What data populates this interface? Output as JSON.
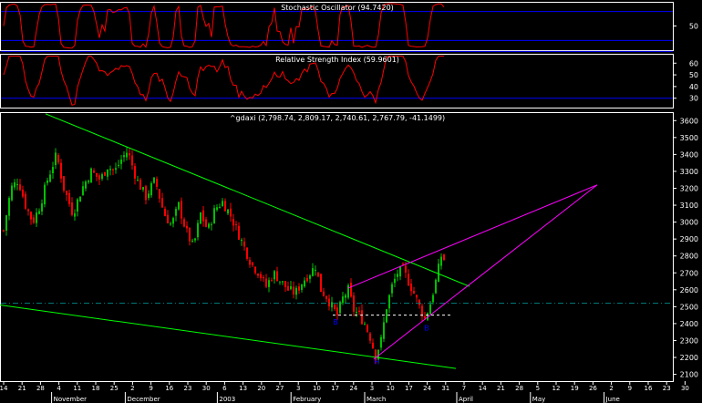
{
  "panels": {
    "stoch": {
      "title": "Stochastic Oscillator (94.7420)",
      "ylim": [
        0,
        100
      ],
      "ticks": [
        50
      ],
      "levels": [
        20,
        80
      ]
    },
    "rsi": {
      "title": "Relative Strength Index (59.9601)",
      "ylim": [
        22,
        68
      ],
      "ticks": [
        30,
        40,
        50,
        60
      ],
      "levels": [
        30,
        70
      ]
    },
    "price": {
      "title": "^gdaxi (2,798.74, 2,809.17, 2,740.61, 2,767.79, -41.1499)",
      "ylim": [
        2060,
        3650
      ],
      "ticks": [
        2100,
        2200,
        2300,
        2400,
        2500,
        2600,
        2700,
        2800,
        2900,
        3000,
        3100,
        3200,
        3300,
        3400,
        3500,
        3600
      ],
      "hline": 2520,
      "support_level": 2450
    }
  },
  "xaxis": {
    "day_ticks": [
      "14",
      "21",
      "28",
      "4",
      "11",
      "18",
      "25",
      "2",
      "9",
      "16",
      "23",
      "30",
      "6",
      "13",
      "20",
      "27",
      "3",
      "10",
      "17",
      "24",
      "3",
      "10",
      "17",
      "24",
      "31",
      "7",
      "14",
      "21",
      "28",
      "5",
      "12",
      "19",
      "26",
      "2",
      "9",
      "16",
      "23",
      "30"
    ],
    "month_labels": [
      {
        "label": "November",
        "at": 3
      },
      {
        "label": "December",
        "at": 7
      },
      {
        "label": "2003",
        "at": 12
      },
      {
        "label": "February",
        "at": 16
      },
      {
        "label": "March",
        "at": 20
      },
      {
        "label": "April",
        "at": 25
      },
      {
        "label": "May",
        "at": 29
      },
      {
        "label": "June",
        "at": 33
      }
    ]
  },
  "annotations": [
    {
      "text": "B",
      "x": 368,
      "y": 2395
    },
    {
      "text": "H",
      "x": 413,
      "y": 2160
    },
    {
      "text": "B",
      "x": 468,
      "y": 2360
    }
  ],
  "colors": {
    "bull": "#00c000",
    "bear": "#ff0000",
    "trend": "#00ff00",
    "wedge": "#ff00ff",
    "level_line": "#0000ff",
    "osc": "#ff0000",
    "text": "#ffffff",
    "annotation": "#0000ff",
    "dashdot": "#008080"
  },
  "chart_data": {
    "type": "candlestick",
    "title": "^gdaxi (2,798.74, 2,809.17, 2,740.61, 2,767.79, -41.1499)",
    "ylim": [
      2060,
      3650
    ],
    "close_anchors": [
      {
        "x": 4,
        "close": 2950
      },
      {
        "x": 12,
        "close": 3200
      },
      {
        "x": 20,
        "close": 3250
      },
      {
        "x": 28,
        "close": 3100
      },
      {
        "x": 36,
        "close": 3000
      },
      {
        "x": 44,
        "close": 3100
      },
      {
        "x": 52,
        "close": 3250
      },
      {
        "x": 62,
        "close": 3400
      },
      {
        "x": 70,
        "close": 3200
      },
      {
        "x": 80,
        "close": 3050
      },
      {
        "x": 90,
        "close": 3200
      },
      {
        "x": 100,
        "close": 3300
      },
      {
        "x": 110,
        "close": 3250
      },
      {
        "x": 118,
        "close": 3330
      },
      {
        "x": 126,
        "close": 3300
      },
      {
        "x": 134,
        "close": 3380
      },
      {
        "x": 140,
        "close": 3420
      },
      {
        "x": 150,
        "close": 3250
      },
      {
        "x": 160,
        "close": 3150
      },
      {
        "x": 170,
        "close": 3250
      },
      {
        "x": 180,
        "close": 3050
      },
      {
        "x": 188,
        "close": 2980
      },
      {
        "x": 196,
        "close": 3100
      },
      {
        "x": 204,
        "close": 2950
      },
      {
        "x": 212,
        "close": 2850
      },
      {
        "x": 220,
        "close": 3050
      },
      {
        "x": 228,
        "close": 2950
      },
      {
        "x": 236,
        "close": 3080
      },
      {
        "x": 244,
        "close": 3120
      },
      {
        "x": 252,
        "close": 3050
      },
      {
        "x": 260,
        "close": 2950
      },
      {
        "x": 268,
        "close": 2850
      },
      {
        "x": 276,
        "close": 2750
      },
      {
        "x": 284,
        "close": 2700
      },
      {
        "x": 292,
        "close": 2620
      },
      {
        "x": 300,
        "close": 2700
      },
      {
        "x": 308,
        "close": 2650
      },
      {
        "x": 316,
        "close": 2600
      },
      {
        "x": 324,
        "close": 2580
      },
      {
        "x": 332,
        "close": 2650
      },
      {
        "x": 340,
        "close": 2700
      },
      {
        "x": 346,
        "close": 2740
      },
      {
        "x": 352,
        "close": 2600
      },
      {
        "x": 358,
        "close": 2560
      },
      {
        "x": 364,
        "close": 2500
      },
      {
        "x": 370,
        "close": 2450
      },
      {
        "x": 376,
        "close": 2550
      },
      {
        "x": 382,
        "close": 2600
      },
      {
        "x": 388,
        "close": 2480
      },
      {
        "x": 394,
        "close": 2450
      },
      {
        "x": 400,
        "close": 2400
      },
      {
        "x": 406,
        "close": 2320
      },
      {
        "x": 412,
        "close": 2210
      },
      {
        "x": 418,
        "close": 2300
      },
      {
        "x": 424,
        "close": 2500
      },
      {
        "x": 430,
        "close": 2620
      },
      {
        "x": 436,
        "close": 2700
      },
      {
        "x": 442,
        "close": 2720
      },
      {
        "x": 448,
        "close": 2650
      },
      {
        "x": 454,
        "close": 2580
      },
      {
        "x": 460,
        "close": 2500
      },
      {
        "x": 466,
        "close": 2430
      },
      {
        "x": 472,
        "close": 2520
      },
      {
        "x": 478,
        "close": 2650
      },
      {
        "x": 484,
        "close": 2800
      },
      {
        "x": 489,
        "close": 2768
      }
    ],
    "trendlines": [
      {
        "name": "upper-downtrend",
        "x": [
          50,
          515
        ],
        "y": [
          3640,
          2620
        ]
      },
      {
        "name": "lower-downtrend",
        "x": [
          0,
          500
        ],
        "y": [
          2510,
          2135
        ]
      },
      {
        "name": "wedge-upper",
        "x": [
          382,
          655
        ],
        "y": [
          2610,
          3220
        ]
      },
      {
        "name": "wedge-lower",
        "x": [
          410,
          655
        ],
        "y": [
          2190,
          3220
        ]
      }
    ]
  }
}
